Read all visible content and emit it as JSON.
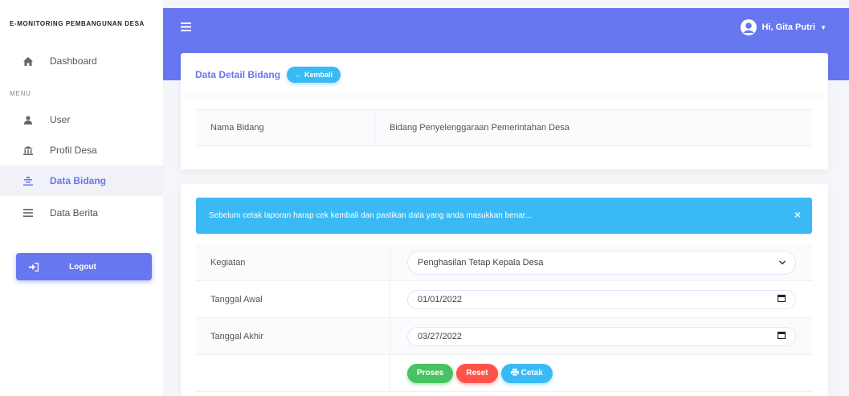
{
  "sidebar": {
    "brand": "E-MONITORING PEMBANGUNAN DESA",
    "dashboard": "Dashboard",
    "menu_header": "MENU",
    "items": [
      {
        "label": "User",
        "icon": "user-icon"
      },
      {
        "label": "Profil Desa",
        "icon": "landmark-icon"
      },
      {
        "label": "Data Bidang",
        "icon": "list-icon",
        "active": true
      },
      {
        "label": "Data Berita",
        "icon": "bars-icon"
      }
    ],
    "logout": "Logout"
  },
  "topbar": {
    "user_greeting": "Hi, Gita Putri",
    "accent_color": "#6777ef"
  },
  "detail": {
    "title": "Data Detail Bidang",
    "back_button": "Kembali",
    "field_label": "Nama Bidang",
    "field_value": "Bidang Penyelenggaraan Pemerintahan Desa"
  },
  "report": {
    "alert_text": "Sebelum cetak laporan harap cek kembali dan pastikan data yang anda masukkan benar...",
    "alert_close": "×",
    "kegiatan_label": "Kegiatan",
    "kegiatan_value": "Penghasilan Tetap Kepala Desa",
    "tanggal_awal_label": "Tanggal Awal",
    "tanggal_awal_value": "01/01/2022",
    "tanggal_akhir_label": "Tanggal Akhir",
    "tanggal_akhir_value": "03/27/2022",
    "btn_proses": "Proses",
    "btn_reset": "Reset",
    "btn_cetak": "Cetak"
  }
}
